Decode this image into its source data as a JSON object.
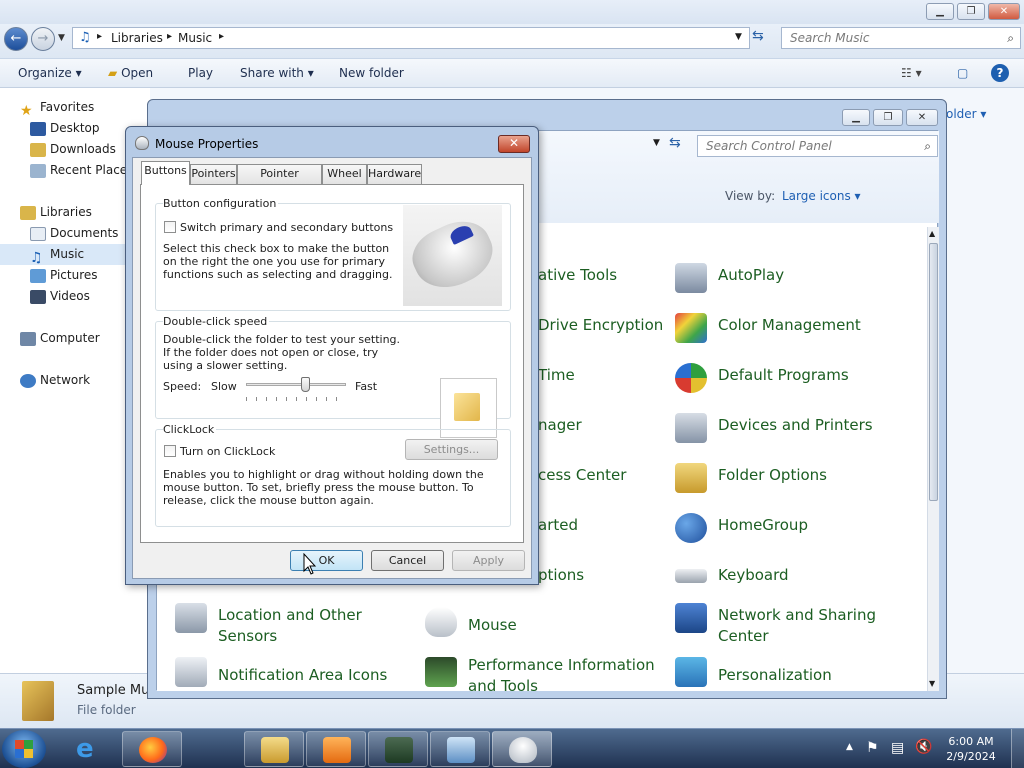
{
  "explorer": {
    "breadcrumb": [
      "Libraries",
      "Music"
    ],
    "search_placeholder": "Search Music",
    "toolbar": {
      "organize": "Organize",
      "open": "Open",
      "play": "Play",
      "share_with": "Share with",
      "new_folder": "New folder"
    },
    "nav": {
      "favorites": "Favorites",
      "desktop": "Desktop",
      "downloads": "Downloads",
      "recent_places": "Recent Places",
      "libraries": "Libraries",
      "documents": "Documents",
      "music": "Music",
      "pictures": "Pictures",
      "videos": "Videos",
      "computer": "Computer",
      "network": "Network"
    },
    "arrange_suffix": "older",
    "details": {
      "name": "Sample Mus",
      "type": "File folder"
    }
  },
  "control_panel": {
    "search_placeholder": "Search Control Panel",
    "view_by_label": "View by:",
    "view_by_value": "Large icons",
    "items": [
      {
        "label": "ative Tools"
      },
      {
        "label": "AutoPlay"
      },
      {
        "label": "Drive Encryption"
      },
      {
        "label": "Color Management"
      },
      {
        "label": "Time"
      },
      {
        "label": "Default Programs"
      },
      {
        "label": "nager"
      },
      {
        "label": "Devices and Printers"
      },
      {
        "label": "cess Center"
      },
      {
        "label": "Folder Options"
      },
      {
        "label": "arted"
      },
      {
        "label": "HomeGroup"
      },
      {
        "label": "ptions"
      },
      {
        "label": "Keyboard"
      },
      {
        "label": "Location and Other"
      },
      {
        "label": "Sensors"
      },
      {
        "label": "Mouse"
      },
      {
        "label": "Network and Sharing"
      },
      {
        "label": "Center"
      },
      {
        "label": "Notification Area Icons"
      },
      {
        "label": "Performance Information"
      },
      {
        "label": "and Tools"
      },
      {
        "label": "Personalization"
      }
    ]
  },
  "dialog": {
    "title": "Mouse Properties",
    "tabs": [
      "Buttons",
      "Pointers",
      "Pointer Options",
      "Wheel",
      "Hardware"
    ],
    "button_config": {
      "title": "Button configuration",
      "checkbox_label": "Switch primary and secondary buttons",
      "description": "Select this check box to make the button on the right the one you use for primary functions such as selecting and dragging.",
      "checked": false
    },
    "double_click": {
      "title": "Double-click speed",
      "description": "Double-click the folder to test your setting. If the folder does not open or close, try using a slower setting.",
      "speed_label": "Speed:",
      "slow_label": "Slow",
      "fast_label": "Fast",
      "speed_fraction": 0.6
    },
    "clicklock": {
      "title": "ClickLock",
      "checkbox_label": "Turn on ClickLock",
      "settings_button": "Settings...",
      "description": "Enables you to highlight or drag without holding down the mouse button. To set, briefly press the mouse button. To release, click the mouse button again.",
      "checked": false
    },
    "ok_label": "OK",
    "cancel_label": "Cancel",
    "apply_label": "Apply"
  },
  "taskbar": {
    "time": "6:00 AM",
    "date": "2/9/2024"
  }
}
